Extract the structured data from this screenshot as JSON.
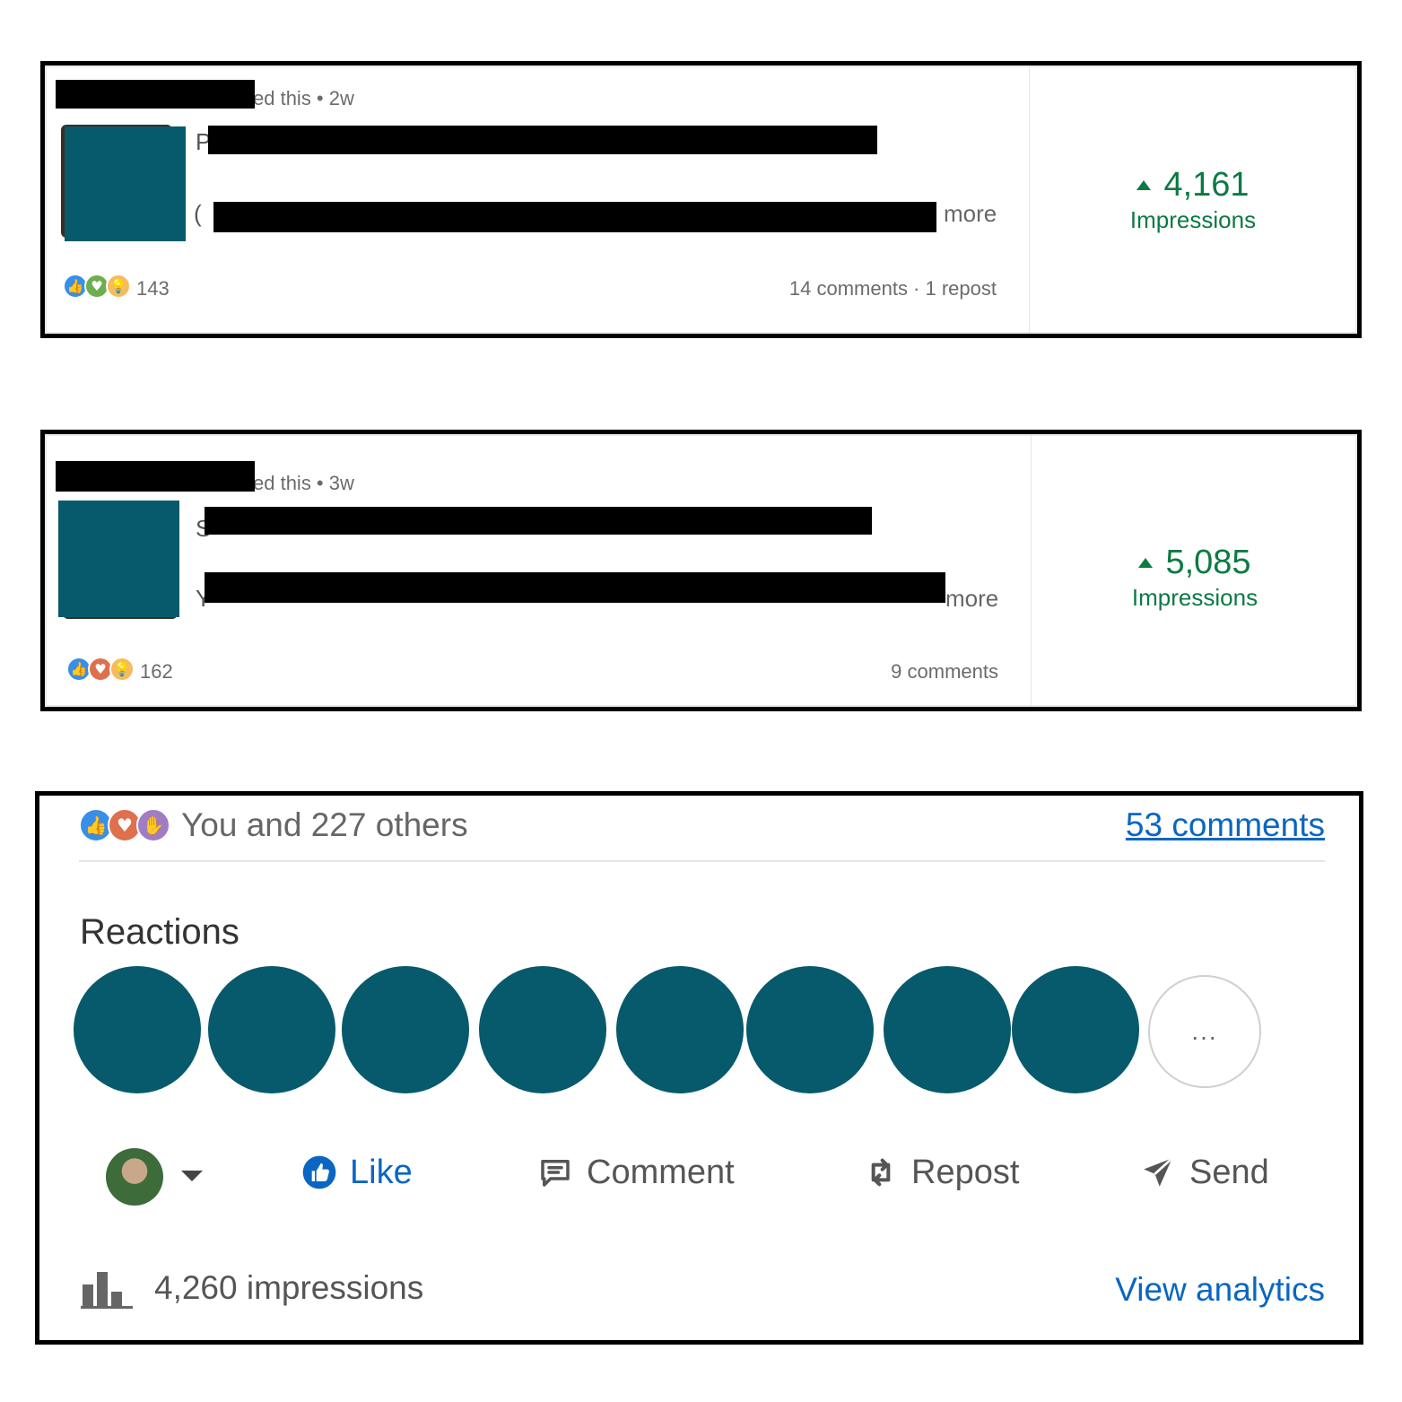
{
  "posts": [
    {
      "meta": "ed this • 2w",
      "title_initial": "P",
      "body_initial": "( ",
      "more_label": "more",
      "reaction_icons": [
        "like-icon",
        "support-icon",
        "insight-icon"
      ],
      "reaction_count": "143",
      "activity": "14 comments · 1 repost",
      "impressions_value": "4,161",
      "impressions_label": "Impressions"
    },
    {
      "meta": "ed this • 3w",
      "title_initial": "S",
      "body_initial": "Y",
      "more_label": "more",
      "reaction_icons": [
        "like-icon",
        "love-icon",
        "insight-icon"
      ],
      "reaction_count": "162",
      "activity": "9 comments",
      "impressions_value": "5,085",
      "impressions_label": "Impressions"
    }
  ],
  "detail": {
    "summary": "You and 227 others",
    "comments_link": "53 comments",
    "reactions_title": "Reactions",
    "more_reactors": "...",
    "actions": {
      "like": "Like",
      "comment": "Comment",
      "repost": "Repost",
      "send": "Send"
    },
    "impressions": "4,260 impressions",
    "analytics_link": "View analytics"
  },
  "colors": {
    "accent_blue": "#0a66c2",
    "impressions_green": "#0c7a43",
    "avatar_teal": "#075a6b"
  }
}
